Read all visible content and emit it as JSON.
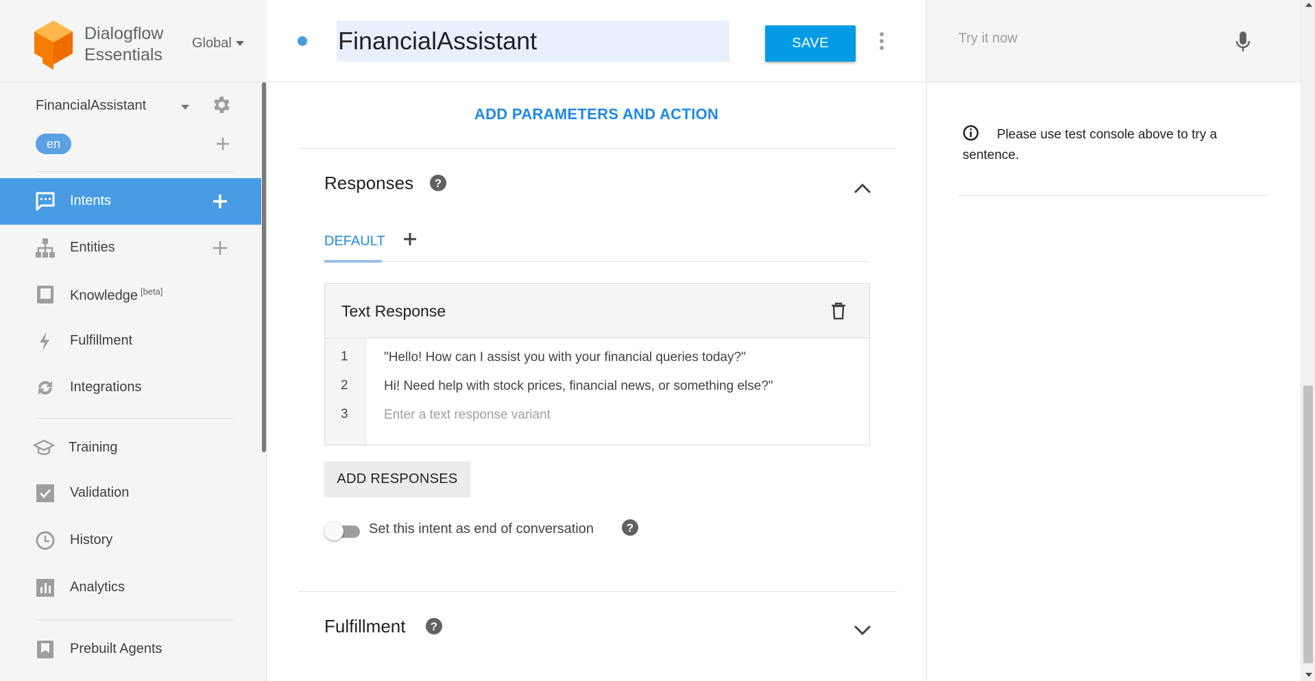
{
  "brand": {
    "line1": "Dialogflow",
    "line2": "Essentials",
    "region": "Global"
  },
  "agent": {
    "name": "FinancialAssistant",
    "language": "en"
  },
  "nav": {
    "intents": "Intents",
    "entities": "Entities",
    "knowledge": "Knowledge",
    "knowledge_badge": "[beta]",
    "fulfillment": "Fulfillment",
    "integrations": "Integrations",
    "training": "Training",
    "validation": "Validation",
    "history": "History",
    "analytics": "Analytics",
    "prebuilt": "Prebuilt Agents"
  },
  "topbar": {
    "intent_name": "FinancialAssistant",
    "save_label": "SAVE"
  },
  "main": {
    "add_params": "ADD PARAMETERS AND ACTION",
    "responses_title": "Responses",
    "tab_default": "DEFAULT",
    "text_response_title": "Text Response",
    "rows": [
      {
        "num": "1",
        "text": "\"Hello! How can I assist you with your financial queries today?\""
      },
      {
        "num": "2",
        "text": "Hi! Need help with stock prices, financial news, or something else?\""
      },
      {
        "num": "3",
        "placeholder": "Enter a text response variant"
      }
    ],
    "add_responses": "ADD RESPONSES",
    "end_conversation_label": "Set this intent as end of conversation",
    "end_conversation_on": false,
    "fulfillment_title": "Fulfillment"
  },
  "test_console": {
    "placeholder": "Try it now",
    "info": "Please use test console above to try a sentence."
  },
  "colors": {
    "accent": "#039be5",
    "active_nav": "#499ce3",
    "link": "#1e88e5",
    "logo_orange": "#ef6c00"
  }
}
